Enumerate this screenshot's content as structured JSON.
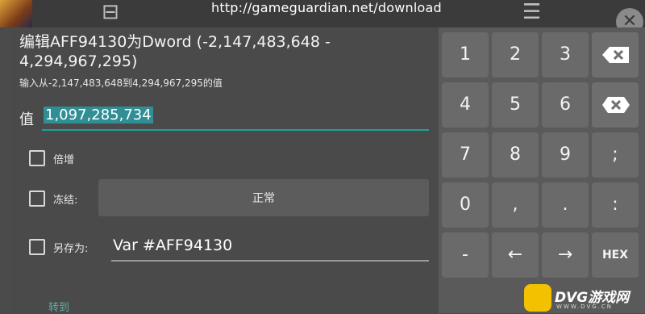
{
  "url_bar": {
    "text": "http://gameguardian.net/download"
  },
  "dialog": {
    "title": "编辑AFF94130为Dword (-2,147,483,648 - 4,294,967,295)",
    "hint": "输入从-2,147,483,648到4,294,967,295的值",
    "value_label": "值",
    "value": "1,097,285,734",
    "checkbox_multiply": "倍增",
    "checkbox_freeze": "冻结:",
    "freeze_mode": "正常",
    "checkbox_saveas": "另存为:",
    "saveas_value": "Var #AFF94130",
    "goto_label": "转到"
  },
  "keypad": {
    "rows": [
      [
        "1",
        "2",
        "3",
        "backspace"
      ],
      [
        "4",
        "5",
        "6",
        "clear"
      ],
      [
        "7",
        "8",
        "9",
        ";"
      ],
      [
        "0",
        ",",
        ".",
        ":"
      ],
      [
        "-",
        "←",
        "→",
        "HEX"
      ]
    ]
  },
  "watermark": {
    "brand": "DVG游戏网",
    "sub": "WWW.DVG.CN"
  },
  "colors": {
    "accent": "#1ba39a",
    "selection": "#2f8f95",
    "background": "#4a4a4a",
    "keypad": "#5a5a5a",
    "key": "#6a6a6a"
  }
}
